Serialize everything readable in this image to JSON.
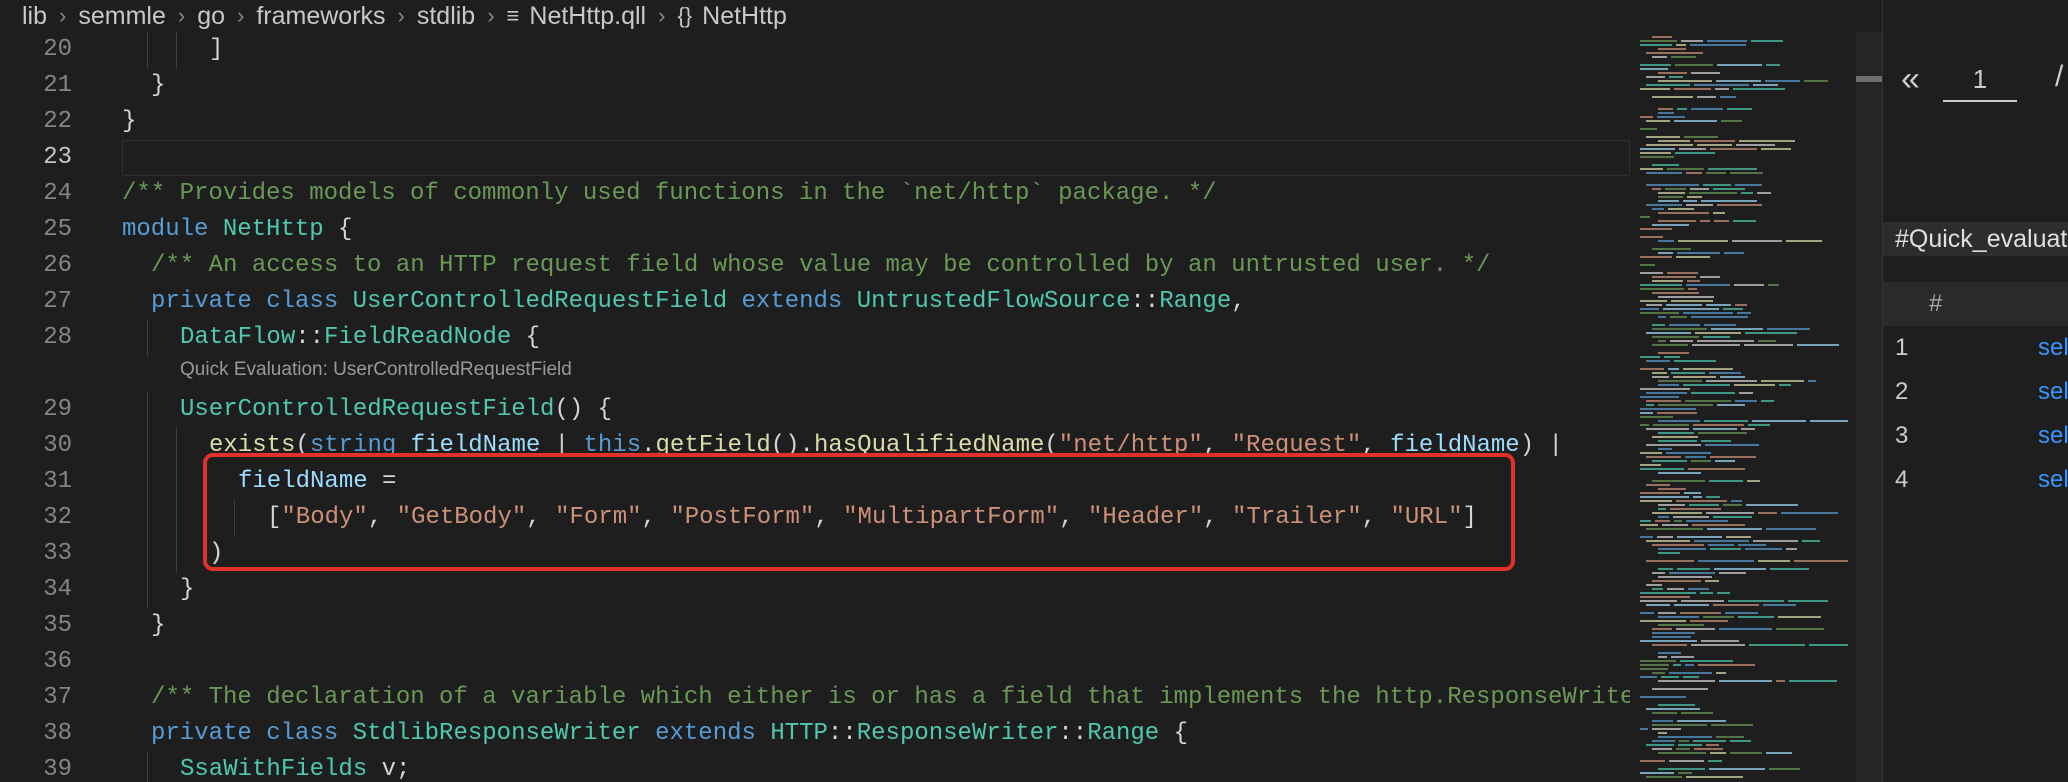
{
  "breadcrumb": {
    "items": [
      "lib",
      "semmle",
      "go",
      "frameworks",
      "stdlib"
    ],
    "file": "NetHttp.qll",
    "symbol": "NetHttp",
    "file_icon": "file-lines-icon",
    "symbol_icon": "braces-icon"
  },
  "editor": {
    "line_numbers": [
      "20",
      "21",
      "22",
      "23",
      "24",
      "25",
      "26",
      "27",
      "28",
      "29",
      "30",
      "31",
      "32",
      "33",
      "34",
      "35",
      "36",
      "37",
      "38",
      "39"
    ],
    "active_line": "23",
    "codelens": "Quick Evaluation: UserControlledRequestField",
    "lines": [
      [
        {
          "t": "pl",
          "v": "]"
        }
      ],
      [
        {
          "t": "pl",
          "v": "}"
        }
      ],
      [
        {
          "t": "pl",
          "v": "}"
        }
      ],
      [],
      [
        {
          "t": "cm",
          "v": "/** Provides models of commonly used functions in the `net/http` package. */"
        }
      ],
      [
        {
          "t": "kw",
          "v": "module "
        },
        {
          "t": "ty",
          "v": "NetHttp"
        },
        {
          "t": "pl",
          "v": " {"
        }
      ],
      [
        {
          "t": "cm",
          "v": "/** An access to an HTTP request field whose value may be controlled by an untrusted user. */"
        }
      ],
      [
        {
          "t": "kw",
          "v": "private class "
        },
        {
          "t": "ty",
          "v": "UserControlledRequestField"
        },
        {
          "t": "kw",
          "v": " extends "
        },
        {
          "t": "ty",
          "v": "UntrustedFlowSource"
        },
        {
          "t": "pl",
          "v": "::"
        },
        {
          "t": "ty",
          "v": "Range"
        },
        {
          "t": "pl",
          "v": ","
        }
      ],
      [
        {
          "t": "ty",
          "v": "DataFlow"
        },
        {
          "t": "pl",
          "v": "::"
        },
        {
          "t": "ty",
          "v": "FieldReadNode"
        },
        {
          "t": "pl",
          "v": " {"
        }
      ],
      [
        {
          "t": "ty",
          "v": "UserControlledRequestField"
        },
        {
          "t": "pl",
          "v": "() {"
        }
      ],
      [
        {
          "t": "fn",
          "v": "exists"
        },
        {
          "t": "pl",
          "v": "("
        },
        {
          "t": "kw",
          "v": "string "
        },
        {
          "t": "va",
          "v": "fieldName"
        },
        {
          "t": "pl",
          "v": " | "
        },
        {
          "t": "kw",
          "v": "this"
        },
        {
          "t": "pl",
          "v": "."
        },
        {
          "t": "fn",
          "v": "getField"
        },
        {
          "t": "pl",
          "v": "()."
        },
        {
          "t": "fn",
          "v": "hasQualifiedName"
        },
        {
          "t": "pl",
          "v": "("
        },
        {
          "t": "st",
          "v": "\"net/http\""
        },
        {
          "t": "pl",
          "v": ", "
        },
        {
          "t": "st",
          "v": "\"Request\""
        },
        {
          "t": "pl",
          "v": ", "
        },
        {
          "t": "va",
          "v": "fieldName"
        },
        {
          "t": "pl",
          "v": ") |"
        }
      ],
      [
        {
          "t": "va",
          "v": "fieldName"
        },
        {
          "t": "pl",
          "v": " ="
        }
      ],
      [
        {
          "t": "pl",
          "v": "["
        },
        {
          "t": "st",
          "v": "\"Body\""
        },
        {
          "t": "pl",
          "v": ", "
        },
        {
          "t": "st",
          "v": "\"GetBody\""
        },
        {
          "t": "pl",
          "v": ", "
        },
        {
          "t": "st",
          "v": "\"Form\""
        },
        {
          "t": "pl",
          "v": ", "
        },
        {
          "t": "st",
          "v": "\"PostForm\""
        },
        {
          "t": "pl",
          "v": ", "
        },
        {
          "t": "st",
          "v": "\"MultipartForm\""
        },
        {
          "t": "pl",
          "v": ", "
        },
        {
          "t": "st",
          "v": "\"Header\""
        },
        {
          "t": "pl",
          "v": ", "
        },
        {
          "t": "st",
          "v": "\"Trailer\""
        },
        {
          "t": "pl",
          "v": ", "
        },
        {
          "t": "st",
          "v": "\"URL\""
        },
        {
          "t": "pl",
          "v": "]"
        }
      ],
      [
        {
          "t": "pl",
          "v": ")"
        }
      ],
      [
        {
          "t": "pl",
          "v": "}"
        }
      ],
      [
        {
          "t": "pl",
          "v": "}"
        }
      ],
      [],
      [
        {
          "t": "cm",
          "v": "/** The declaration of a variable which either is or has a field that implements the http.ResponseWriter type */"
        }
      ],
      [
        {
          "t": "kw",
          "v": "private class "
        },
        {
          "t": "ty",
          "v": "StdlibResponseWriter"
        },
        {
          "t": "kw",
          "v": " extends "
        },
        {
          "t": "ty",
          "v": "HTTP"
        },
        {
          "t": "pl",
          "v": "::"
        },
        {
          "t": "ty",
          "v": "ResponseWriter"
        },
        {
          "t": "pl",
          "v": "::"
        },
        {
          "t": "ty",
          "v": "Range"
        },
        {
          "t": "pl",
          "v": " {"
        }
      ],
      [
        {
          "t": "ty",
          "v": "SsaWithFields"
        },
        {
          "t": "pl",
          "v": " v;"
        }
      ]
    ]
  },
  "results_panel": {
    "prev_icon": "double-chevron-left-icon",
    "page_value": "1",
    "slash": "/",
    "title": "#Quick_evaluation",
    "column_header": "#",
    "rows": [
      {
        "num": "1",
        "link": "select"
      },
      {
        "num": "2",
        "link": "select"
      },
      {
        "num": "3",
        "link": "select"
      },
      {
        "num": "4",
        "link": "select"
      }
    ]
  },
  "colors": {
    "background": "#1e1e1e",
    "highlight_box": "#e0312b",
    "keyword": "#569cd6",
    "type": "#4ec9b0",
    "string": "#ce9178",
    "comment": "#6a9955",
    "link": "#3794ff"
  }
}
